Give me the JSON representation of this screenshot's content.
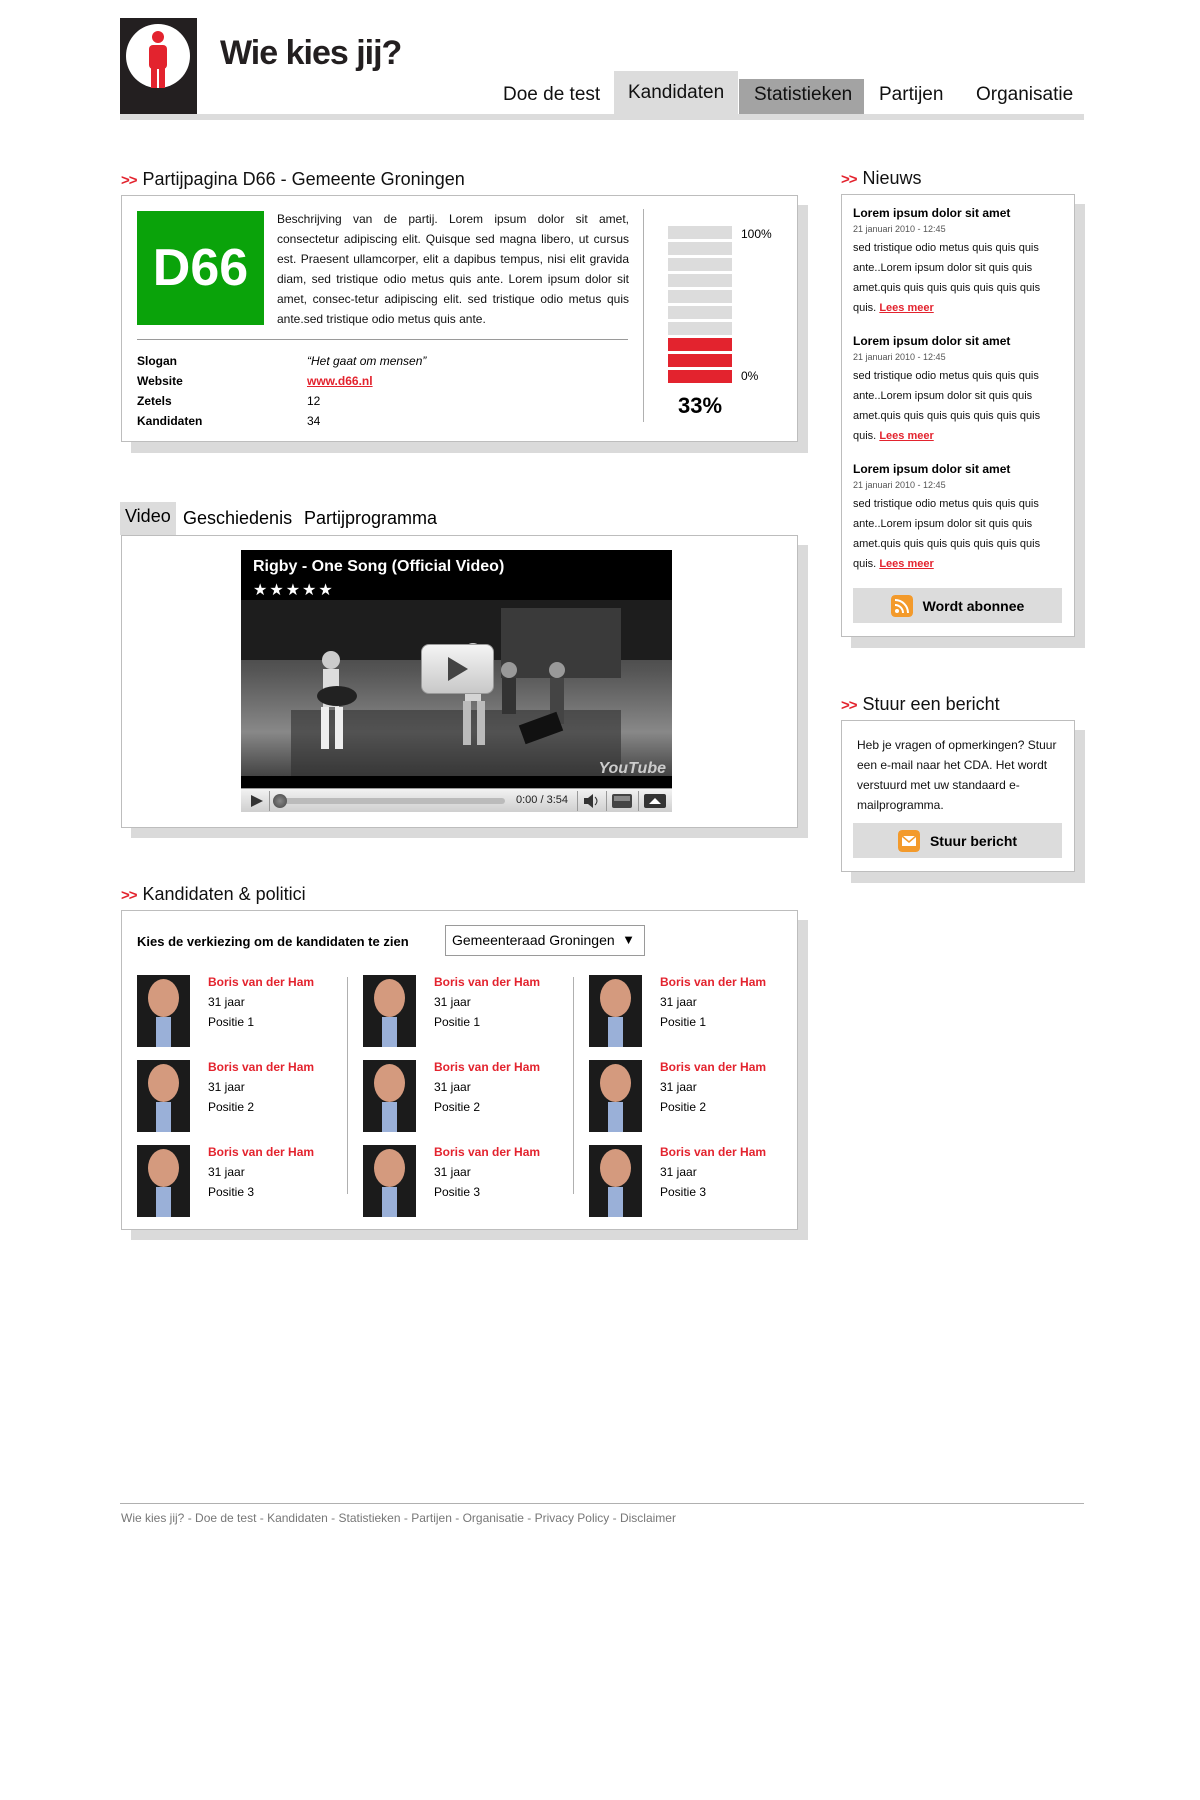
{
  "site": {
    "title": "Wie kies jij?"
  },
  "nav": {
    "items": [
      {
        "label": "Doe de test"
      },
      {
        "label": "Kandidaten"
      },
      {
        "label": "Statistieken"
      },
      {
        "label": "Partijen"
      },
      {
        "label": "Organisatie"
      }
    ],
    "active": "Kandidaten"
  },
  "arrows": ">>",
  "party": {
    "heading": "Partijpagina D66 - Gemeente Groningen",
    "logo_text": "D66",
    "logo_color": "#0aa30a",
    "description": "Beschrijving van de partij. Lorem ipsum dolor sit amet, consectetur adipiscing elit. Quisque sed magna libero, ut cursus est. Praesent ullamcorper, elit a dapibus tempus, nisi elit gravida diam, sed tristique odio metus quis ante. Lorem ipsum dolor sit amet, consec-tetur adipiscing elit. sed tristique odio metus quis ante.sed tristique odio metus quis ante.",
    "info": [
      {
        "label": "Slogan",
        "value": "“Het gaat om mensen”"
      },
      {
        "label": "Website",
        "value": "www.d66.nl"
      },
      {
        "label": "Zetels",
        "value": "12"
      },
      {
        "label": "Kandidaten",
        "value": "34"
      }
    ],
    "score": {
      "top_label": "100%",
      "bottom_label": "0%",
      "value_text": "33%",
      "fraction": 0.33,
      "segments": 10,
      "filled_segments": 3,
      "fill_color": "#e3232e",
      "empty_color": "#dcdcdc"
    }
  },
  "tabs": {
    "items": [
      {
        "label": "Video"
      },
      {
        "label": "Geschiedenis"
      },
      {
        "label": "Partijprogramma"
      }
    ],
    "active": "Video"
  },
  "video": {
    "title": "Rigby - One Song (Official Video)",
    "stars": "★★★★★",
    "time": "0:00 / 3:54",
    "brand": "YouTube"
  },
  "candidates": {
    "heading": "Kandidaten & politici",
    "select_label": "Kies de verkiezing om de kandidaten te zien",
    "select_value": "Gemeenteraad Groningen",
    "items": [
      {
        "name": "Boris van der Ham",
        "age": "31 jaar",
        "position": "Positie 1"
      },
      {
        "name": "Boris van der Ham",
        "age": "31 jaar",
        "position": "Positie 1"
      },
      {
        "name": "Boris van der Ham",
        "age": "31 jaar",
        "position": "Positie 1"
      },
      {
        "name": "Boris van der Ham",
        "age": "31 jaar",
        "position": "Positie 2"
      },
      {
        "name": "Boris van der Ham",
        "age": "31 jaar",
        "position": "Positie 2"
      },
      {
        "name": "Boris van der Ham",
        "age": "31 jaar",
        "position": "Positie 2"
      },
      {
        "name": "Boris van der Ham",
        "age": "31 jaar",
        "position": "Positie 3"
      },
      {
        "name": "Boris van der Ham",
        "age": "31 jaar",
        "position": "Positie 3"
      },
      {
        "name": "Boris van der Ham",
        "age": "31 jaar",
        "position": "Positie 3"
      }
    ]
  },
  "news": {
    "heading": "Nieuws",
    "items": [
      {
        "title": "Lorem ipsum dolor sit amet",
        "date": "21 januari 2010 - 12:45",
        "body": "sed tristique odio metus quis quis quis ante..Lorem ipsum dolor sit quis quis amet.quis quis quis quis quis quis quis quis.",
        "more": "Lees meer"
      },
      {
        "title": "Lorem ipsum dolor sit amet",
        "date": "21 januari 2010 - 12:45",
        "body": "sed tristique odio metus quis quis quis ante..Lorem ipsum dolor sit quis quis amet.quis quis quis quis quis quis quis quis.",
        "more": "Lees meer"
      },
      {
        "title": "Lorem ipsum dolor sit amet",
        "date": "21 januari 2010 - 12:45",
        "body": "sed tristique odio metus quis quis quis ante..Lorem ipsum dolor sit quis quis amet.quis quis quis quis quis quis quis quis.",
        "more": "Lees meer"
      }
    ],
    "subscribe_label": "Wordt abonnee"
  },
  "message": {
    "heading": "Stuur een bericht",
    "text": "Heb je vragen of opmerkingen? Stuur een e-mail naar het CDA. Het wordt verstuurd met uw standaard e-mailprogramma.",
    "button_label": "Stuur bericht"
  },
  "footer": {
    "links": [
      "Wie kies jij?",
      "Doe de test",
      "Kandidaten",
      "Statistieken",
      "Partijen",
      "Organisatie",
      "Privacy Policy",
      "Disclaimer"
    ],
    "separator": " - "
  },
  "colors": {
    "accent": "#e3232e",
    "party_green": "#0aa30a",
    "panel_grey": "#dcdcdc"
  }
}
